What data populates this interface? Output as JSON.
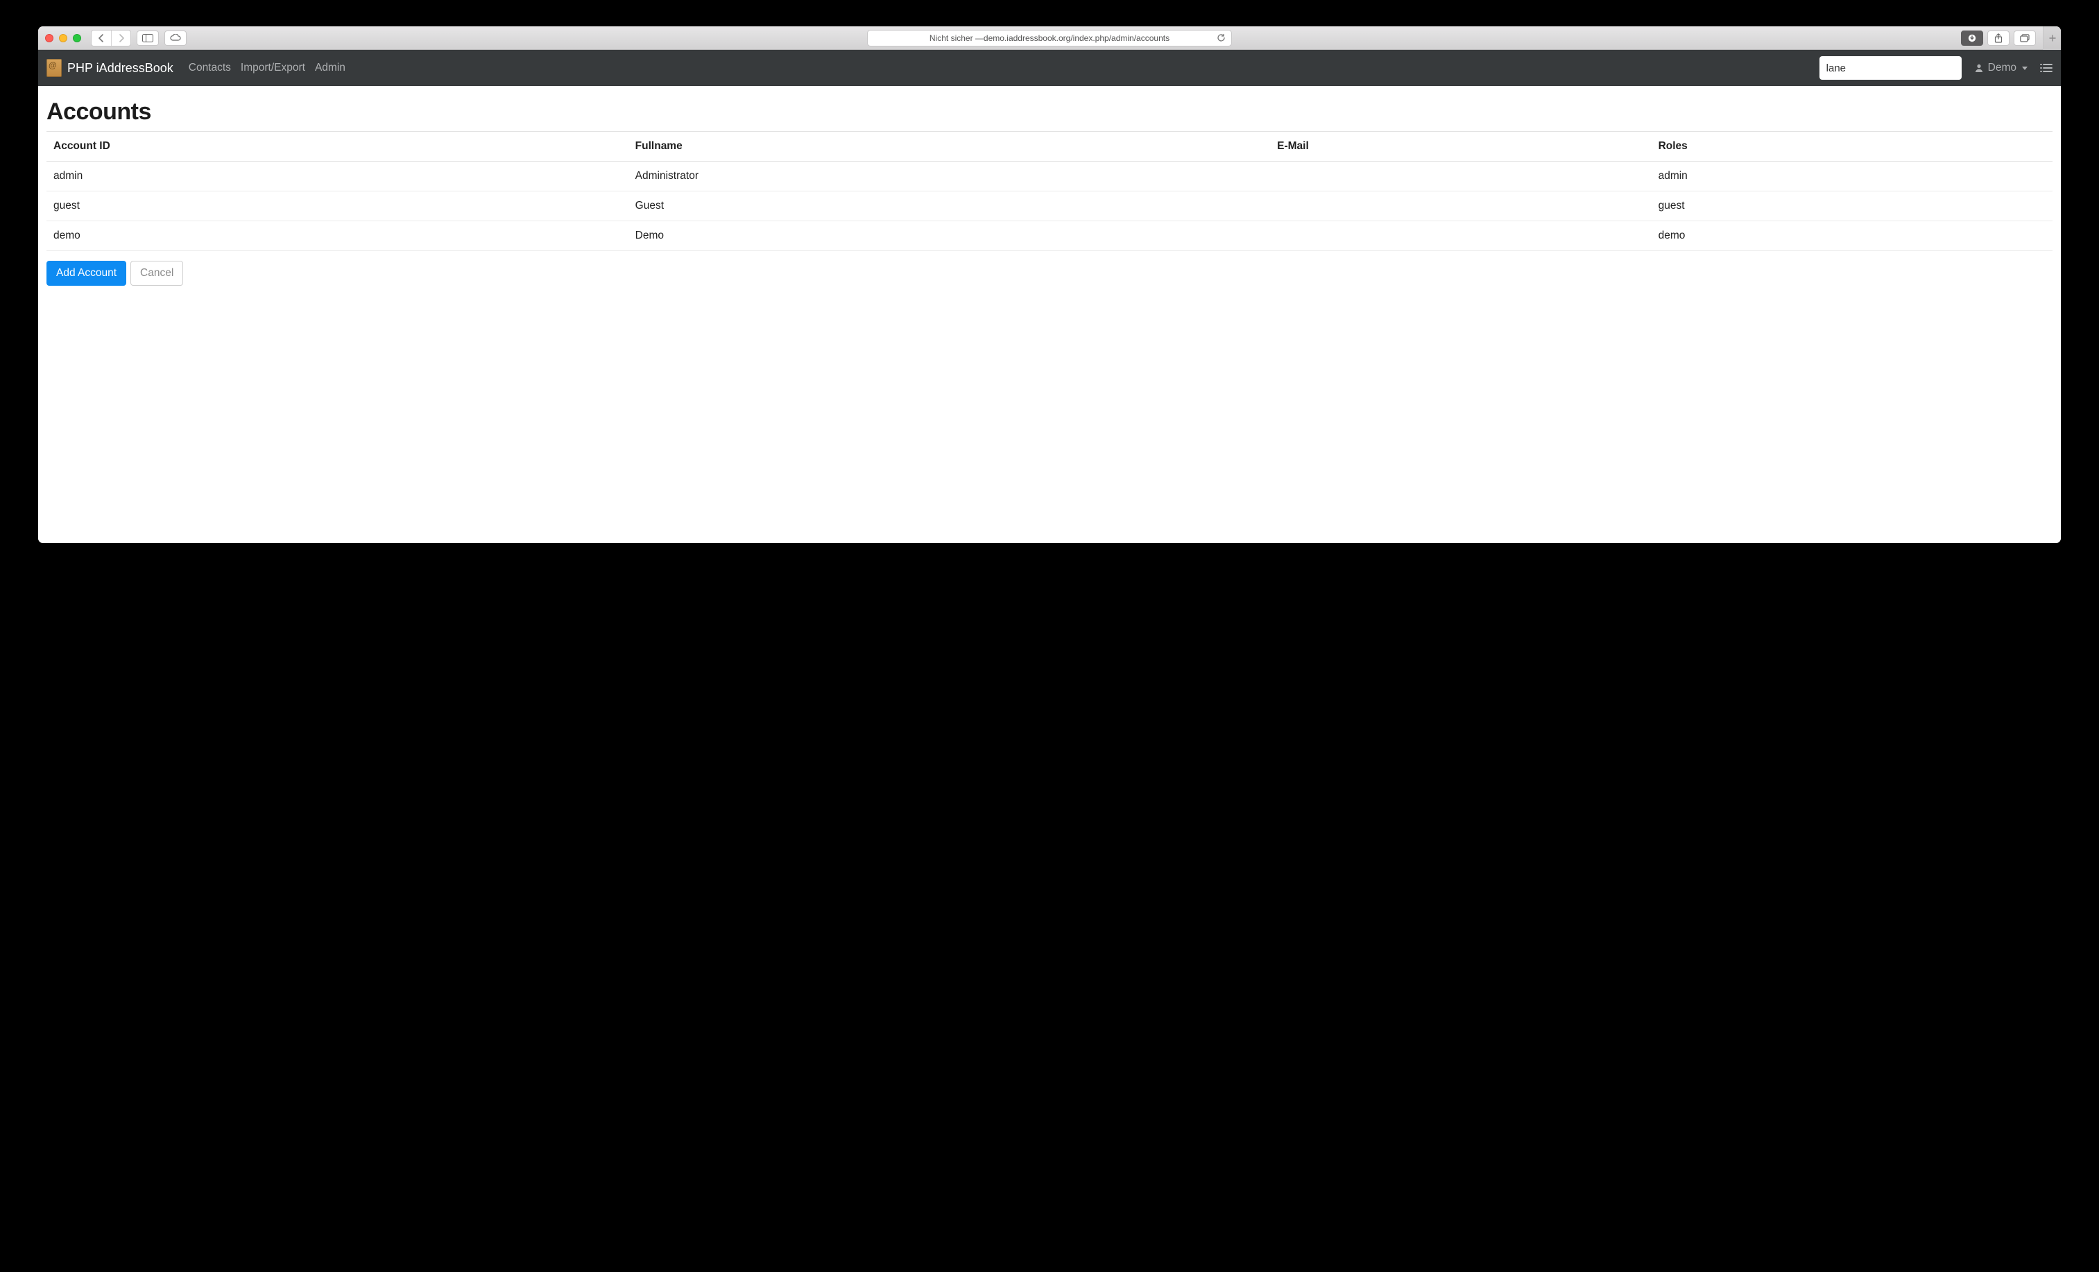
{
  "browser": {
    "address_prefix": "Nicht sicher — ",
    "address": "demo.iaddressbook.org/index.php/admin/accounts"
  },
  "brand": {
    "title": "PHP iAddressBook"
  },
  "nav": {
    "contacts": "Contacts",
    "import_export": "Import/Export",
    "admin": "Admin"
  },
  "search": {
    "value": "lane"
  },
  "user": {
    "name": "Demo"
  },
  "page": {
    "title": "Accounts"
  },
  "table": {
    "headers": {
      "account_id": "Account ID",
      "fullname": "Fullname",
      "email": "E-Mail",
      "roles": "Roles"
    },
    "rows": [
      {
        "account_id": "admin",
        "fullname": "Administrator",
        "email": "",
        "roles": "admin"
      },
      {
        "account_id": "guest",
        "fullname": "Guest",
        "email": "",
        "roles": "guest"
      },
      {
        "account_id": "demo",
        "fullname": "Demo",
        "email": "",
        "roles": "demo"
      }
    ]
  },
  "buttons": {
    "add_account": "Add Account",
    "cancel": "Cancel"
  }
}
